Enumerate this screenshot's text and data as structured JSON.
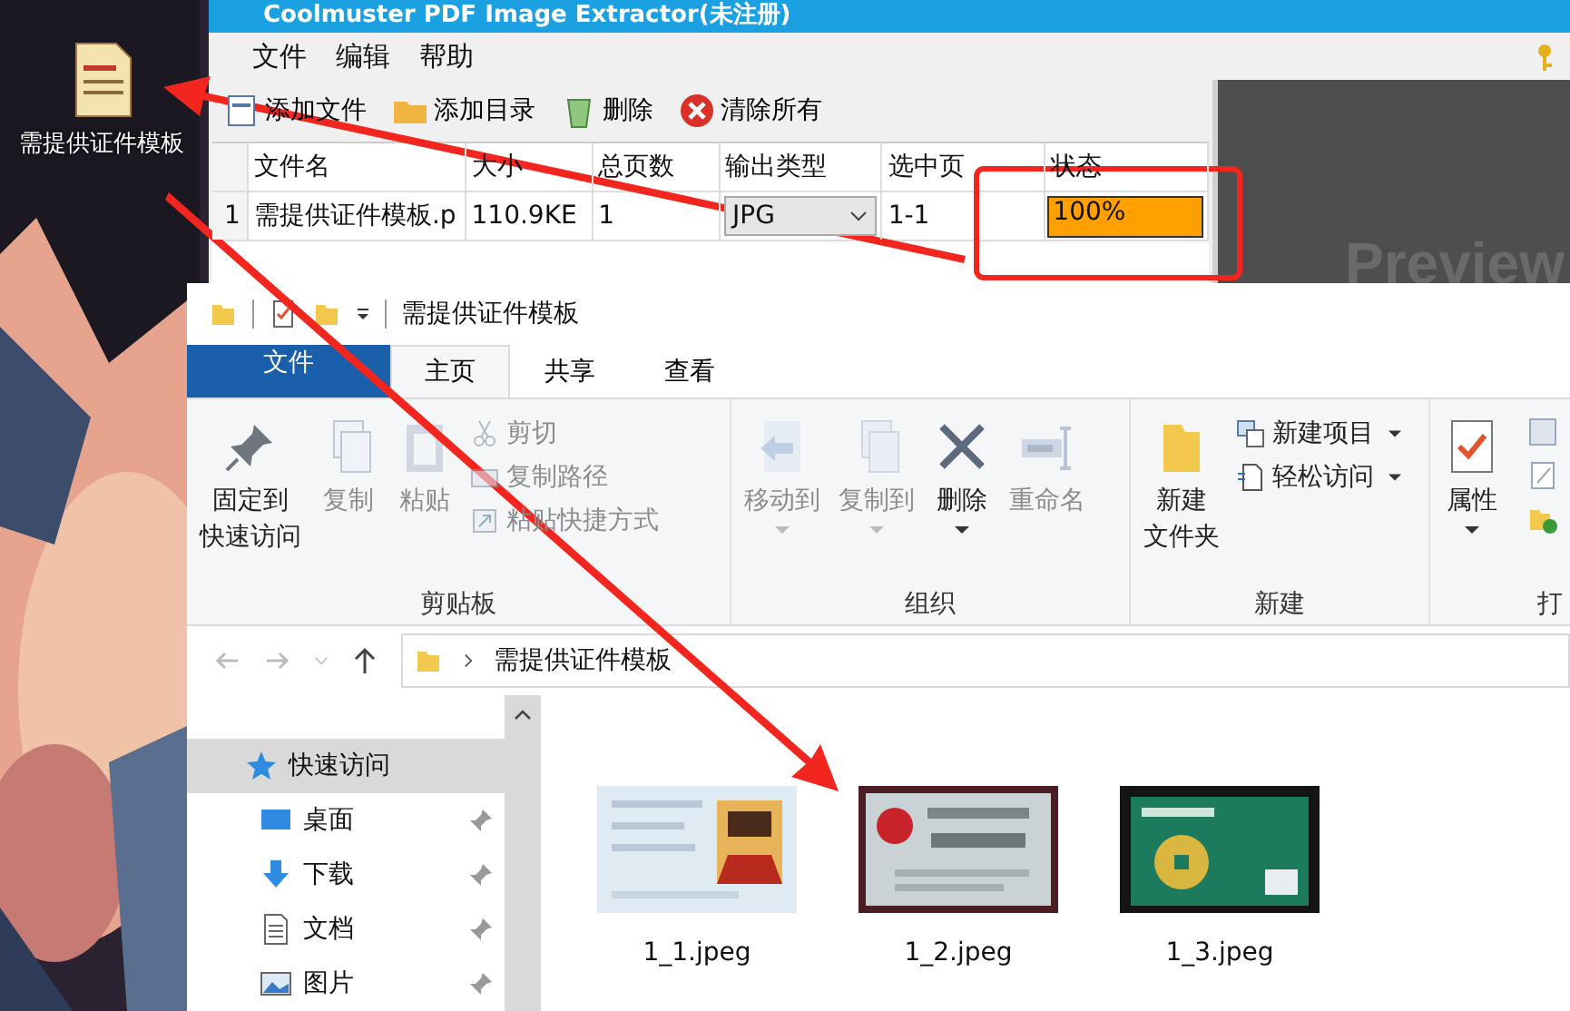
{
  "desktop_icon": {
    "label": "需提供证件模板"
  },
  "extractor": {
    "title": "Coolmuster PDF Image Extractor(未注册)",
    "menu": [
      "文件",
      "编辑",
      "帮助"
    ],
    "toolbar": [
      {
        "label": "添加文件"
      },
      {
        "label": "添加目录"
      },
      {
        "label": "删除"
      },
      {
        "label": "清除所有"
      }
    ],
    "columns": [
      "文件名",
      "大小",
      "总页数",
      "输出类型",
      "选中页",
      "状态"
    ],
    "rows": [
      {
        "index": "1",
        "name": "需提供证件模板.p",
        "size": "110.9KE",
        "pages": "1",
        "output_type": "JPG",
        "selected_pages": "1-1",
        "status": "100%",
        "level": 1
      }
    ],
    "preview_label": "Preview"
  },
  "explorer": {
    "title": "需提供证件模板",
    "tabs": [
      {
        "label": "文件",
        "kind": "file",
        "selected": false
      },
      {
        "label": "主页",
        "kind": "tab",
        "selected": true
      },
      {
        "label": "共享",
        "kind": "tab",
        "selected": false
      },
      {
        "label": "查看",
        "kind": "tab",
        "selected": false
      }
    ],
    "groups": [
      {
        "label": "剪贴板",
        "items": [
          {
            "lines": [
              "固定到",
              "快速访问"
            ],
            "kind": "big",
            "disabled": false
          },
          {
            "lines": [
              "复制"
            ],
            "kind": "big",
            "disabled": true
          },
          {
            "lines": [
              "粘贴"
            ],
            "kind": "big",
            "disabled": true
          },
          {
            "label": "剪切",
            "kind": "small",
            "disabled": true
          },
          {
            "label": "复制路径",
            "kind": "small",
            "disabled": true
          },
          {
            "label": "粘贴快捷方式",
            "kind": "small",
            "disabled": true
          }
        ]
      },
      {
        "label": "组织",
        "items": [
          {
            "lines": [
              "移动到"
            ],
            "kind": "big",
            "disabled": true
          },
          {
            "lines": [
              "复制到"
            ],
            "kind": "big",
            "disabled": true
          },
          {
            "lines": [
              "删除"
            ],
            "kind": "big",
            "disabled": false
          },
          {
            "lines": [
              "重命名"
            ],
            "kind": "big",
            "disabled": true
          }
        ]
      },
      {
        "label": "新建",
        "items": [
          {
            "lines": [
              "新建",
              "文件夹"
            ],
            "kind": "big",
            "disabled": false
          },
          {
            "label": "新建项目",
            "kind": "small",
            "disabled": false
          },
          {
            "label": "轻松访问",
            "kind": "small",
            "disabled": false
          }
        ]
      },
      {
        "label": "打",
        "items": [
          {
            "lines": [
              "属性"
            ],
            "kind": "big",
            "disabled": false
          }
        ]
      }
    ],
    "address": "需提供证件模板",
    "nav": [
      {
        "label": "快速访问",
        "selected": true,
        "pinned": false
      },
      {
        "label": "桌面",
        "selected": false,
        "pinned": true
      },
      {
        "label": "下载",
        "selected": false,
        "pinned": true
      },
      {
        "label": "文档",
        "selected": false,
        "pinned": true
      },
      {
        "label": "图片",
        "selected": false,
        "pinned": true
      }
    ],
    "files": [
      {
        "name": "1_1.jpeg",
        "kind": "picture"
      },
      {
        "name": "1_2.jpeg",
        "kind": "picture"
      },
      {
        "name": "1_3.jpeg",
        "kind": "picture"
      }
    ]
  }
}
